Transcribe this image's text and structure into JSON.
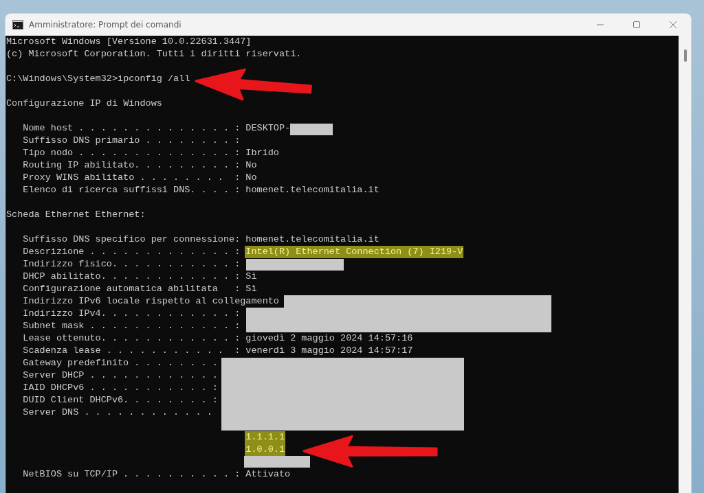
{
  "window": {
    "title": "Amministratore: Prompt dei comandi"
  },
  "console": {
    "lines": [
      {
        "kind": "text",
        "text": "Microsoft Windows [Versione 10.0.22631.3447]"
      },
      {
        "kind": "text",
        "text": "(c) Microsoft Corporation. Tutti i diritti riservati."
      },
      {
        "kind": "blank"
      },
      {
        "kind": "text",
        "text": "C:\\Windows\\System32>ipconfig /all"
      },
      {
        "kind": "blank"
      },
      {
        "kind": "text",
        "text": "Configurazione IP di Windows"
      },
      {
        "kind": "blank"
      },
      {
        "kind": "field",
        "label": "Nome host . . . . . . . . . . . . . . :",
        "value": "DESKTOP-",
        "highlighted": false
      },
      {
        "kind": "field",
        "label": "Suffisso DNS primario . . . . . . . . :"
      },
      {
        "kind": "field",
        "label": "Tipo nodo . . . . . . . . . . . . . . :",
        "value": "Ibrido",
        "highlighted": false
      },
      {
        "kind": "field",
        "label": "Routing IP abilitato. . . . . . . . . :",
        "value": "No",
        "highlighted": false
      },
      {
        "kind": "field",
        "label": "Proxy WINS abilitato . . . . . . . .  :",
        "value": "No",
        "highlighted": false
      },
      {
        "kind": "field",
        "label": "Elenco di ricerca suffissi DNS. . . . :",
        "value": "homenet.telecomitalia.it",
        "highlighted": false
      },
      {
        "kind": "blank"
      },
      {
        "kind": "text",
        "text": "Scheda Ethernet Ethernet:"
      },
      {
        "kind": "blank"
      },
      {
        "kind": "field",
        "label": "Suffisso DNS specifico per connessione:",
        "value": "homenet.telecomitalia.it",
        "highlighted": false
      },
      {
        "kind": "field",
        "label": "Descrizione . . . . . . . . . . . . . :",
        "value": "Intel(R) Ethernet Connection (7) I219-V",
        "highlighted": true
      },
      {
        "kind": "field",
        "label": "Indirizzo fisico. . . . . . . . . . . :"
      },
      {
        "kind": "field",
        "label": "DHCP abilitato. . . . . . . . . . . . :",
        "value": "Sì",
        "highlighted": false
      },
      {
        "kind": "field",
        "label": "Configurazione automatica abilitata   :",
        "value": "Sì",
        "highlighted": false
      },
      {
        "kind": "field",
        "label": "Indirizzo IPv6 locale rispetto al collegamento"
      },
      {
        "kind": "field",
        "label": "Indirizzo IPv4. . . . . . . . . . . . :"
      },
      {
        "kind": "field",
        "label": "Subnet mask . . . . . . . . . . . . . :"
      },
      {
        "kind": "field",
        "label": "Lease ottenuto. . . . . . . . . . . . :",
        "value": "giovedì 2 maggio 2024 14:57:16",
        "highlighted": false
      },
      {
        "kind": "field",
        "label": "Scadenza lease . . . . . . . . . . .  :",
        "value": "venerdì 3 maggio 2024 14:57:17",
        "highlighted": false
      },
      {
        "kind": "field",
        "label": "Gateway predefinito . . . . . . . ."
      },
      {
        "kind": "field",
        "label": "Server DHCP . . . . . . . . . . . ."
      },
      {
        "kind": "field",
        "label": "IAID DHCPv6 . . . . . . . . . . . :"
      },
      {
        "kind": "field",
        "label": "DUID Client DHCPv6. . . . . . . . :"
      },
      {
        "kind": "field",
        "label": "Server DNS . . . . . . . . . . . ."
      },
      {
        "kind": "blank"
      },
      {
        "kind": "value",
        "value": "1.1.1.1",
        "highlighted": true
      },
      {
        "kind": "value",
        "value": "1.0.0.1",
        "highlighted": true
      },
      {
        "kind": "blank"
      },
      {
        "kind": "field",
        "label": "NetBIOS su TCP/IP . . . . . . . . . . :",
        "value": "Attivato",
        "highlighted": false
      }
    ]
  }
}
